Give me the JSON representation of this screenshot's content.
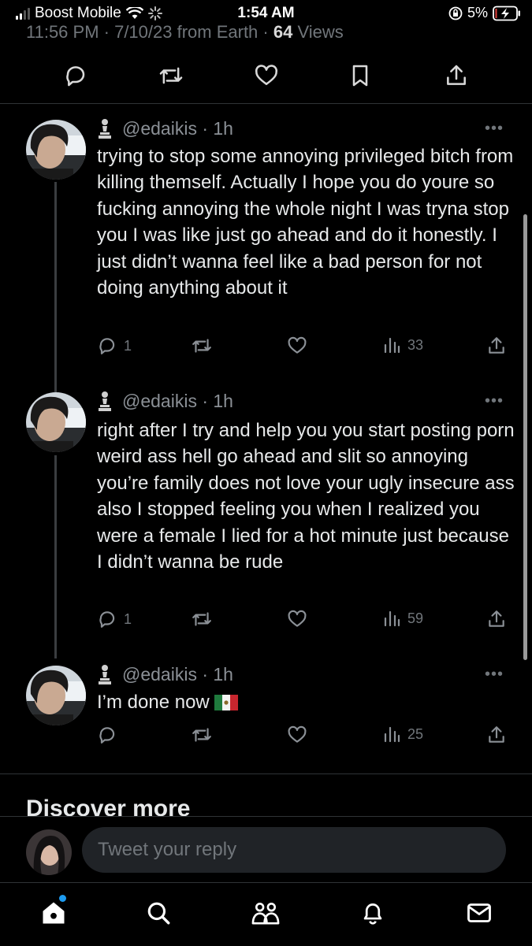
{
  "status_bar": {
    "carrier": "Boost Mobile",
    "time": "1:54 AM",
    "battery": "5%"
  },
  "tweet_meta": {
    "timestamp": "11:56 PM · 7/10/23 from Earth · ",
    "views_count": "64",
    "views_label": " Views"
  },
  "replies": [
    {
      "handle": "@edaikis · 1h",
      "text": "trying to stop some annoying privileged bitch from killing themself. Actually I hope you do youre so fucking annoying the whole night I was tryna stop you I was like just go ahead and do it honestly.  I just didn’t wanna feel like a bad person for not doing anything about it",
      "reply_count": "1",
      "views": "33"
    },
    {
      "handle": "@edaikis · 1h",
      "text": "right after I try and help you you start posting porn weird ass hell go ahead and slit so annoying you’re family does not love your ugly insecure ass also I stopped feeling you when I realized you were a female I lied for a hot minute just because I didn’t wanna be rude",
      "reply_count": "1",
      "views": "59"
    },
    {
      "handle": "@edaikis · 1h",
      "text": "I’m done now",
      "reply_count": "",
      "views": "25"
    }
  ],
  "discover_heading": "Discover more",
  "reply_box": {
    "placeholder": "Tweet your reply"
  },
  "colors": {
    "background": "#000000",
    "text": "#e7e9ea",
    "muted": "#71767b",
    "accent": "#1d9bf0",
    "divider": "#2f3336"
  },
  "icons": [
    "reply-icon",
    "retweet-icon",
    "like-icon",
    "bookmark-icon",
    "share-icon",
    "views-icon",
    "more-icon",
    "home-icon",
    "search-icon",
    "communities-icon",
    "notifications-icon",
    "messages-icon"
  ]
}
